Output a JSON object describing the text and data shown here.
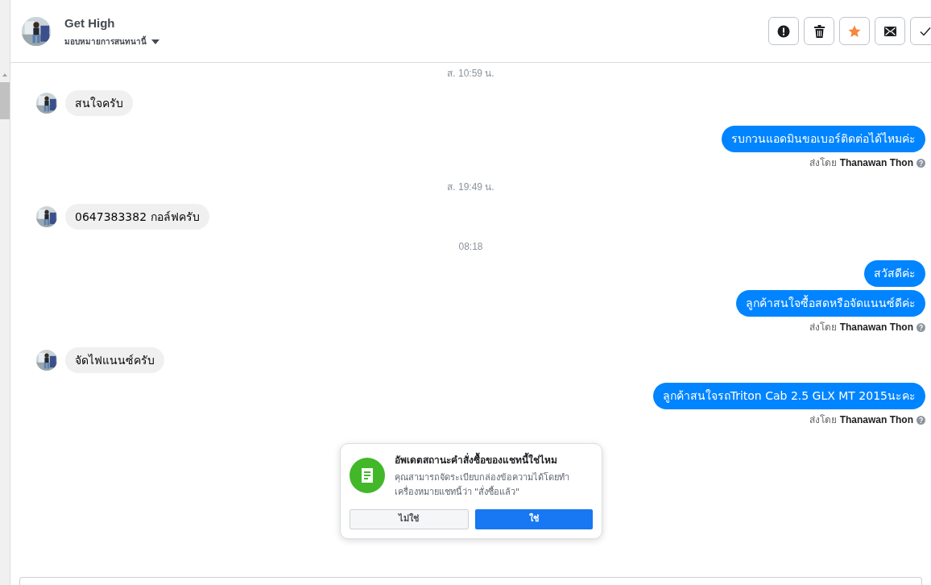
{
  "header": {
    "name": "Get High",
    "assign_label": "มอบหมายการสนทนานี้",
    "actions": [
      {
        "kind": "alert"
      },
      {
        "kind": "trash"
      },
      {
        "kind": "star"
      },
      {
        "kind": "mail"
      },
      {
        "kind": "check"
      }
    ]
  },
  "messages": [
    {
      "kind": "timestamp",
      "text": "ส. 10:59 น."
    },
    {
      "kind": "incoming",
      "text": "สนใจครับ"
    },
    {
      "kind": "outgoing",
      "text": "รบกวนแอดมินขอเบอร์ติดต่อได้ไหมค่ะ"
    },
    {
      "kind": "sent_by",
      "label": "ส่งโดย",
      "name": "Thanawan Thon"
    },
    {
      "kind": "timestamp",
      "text": "ส. 19:49 น."
    },
    {
      "kind": "incoming",
      "text": "0647383382 กอล์ฟครับ"
    },
    {
      "kind": "timestamp",
      "text": "08:18"
    },
    {
      "kind": "outgoing",
      "text": "สวัสดีค่ะ"
    },
    {
      "kind": "outgoing",
      "text": "ลูกค้าสนใจซื้อสดหรือจัดแนนซ์ดีค่ะ"
    },
    {
      "kind": "sent_by",
      "label": "ส่งโดย",
      "name": "Thanawan Thon"
    },
    {
      "kind": "incoming",
      "text": "จัดไฟแนนซ์ครับ"
    },
    {
      "kind": "outgoing",
      "text": "ลูกค้าสนใจรถTriton Cab 2.5 GLX MT 2015นะคะ"
    },
    {
      "kind": "sent_by",
      "label": "ส่งโดย",
      "name": "Thanawan Thon"
    }
  ],
  "prompt": {
    "title": "อัพเดตสถานะคำสั่งซื้อของแชทนี้ใช่ไหม",
    "body": "คุณสามารถจัดระเบียบกล่องข้อความได้โดยทำเครื่องหมายแชทนี้ว่า \"สั่งซื้อแล้ว\"",
    "buttons": [
      {
        "label": "ไม่ใช่",
        "kind": "secondary"
      },
      {
        "label": "ใช่",
        "kind": "primary"
      }
    ]
  }
}
